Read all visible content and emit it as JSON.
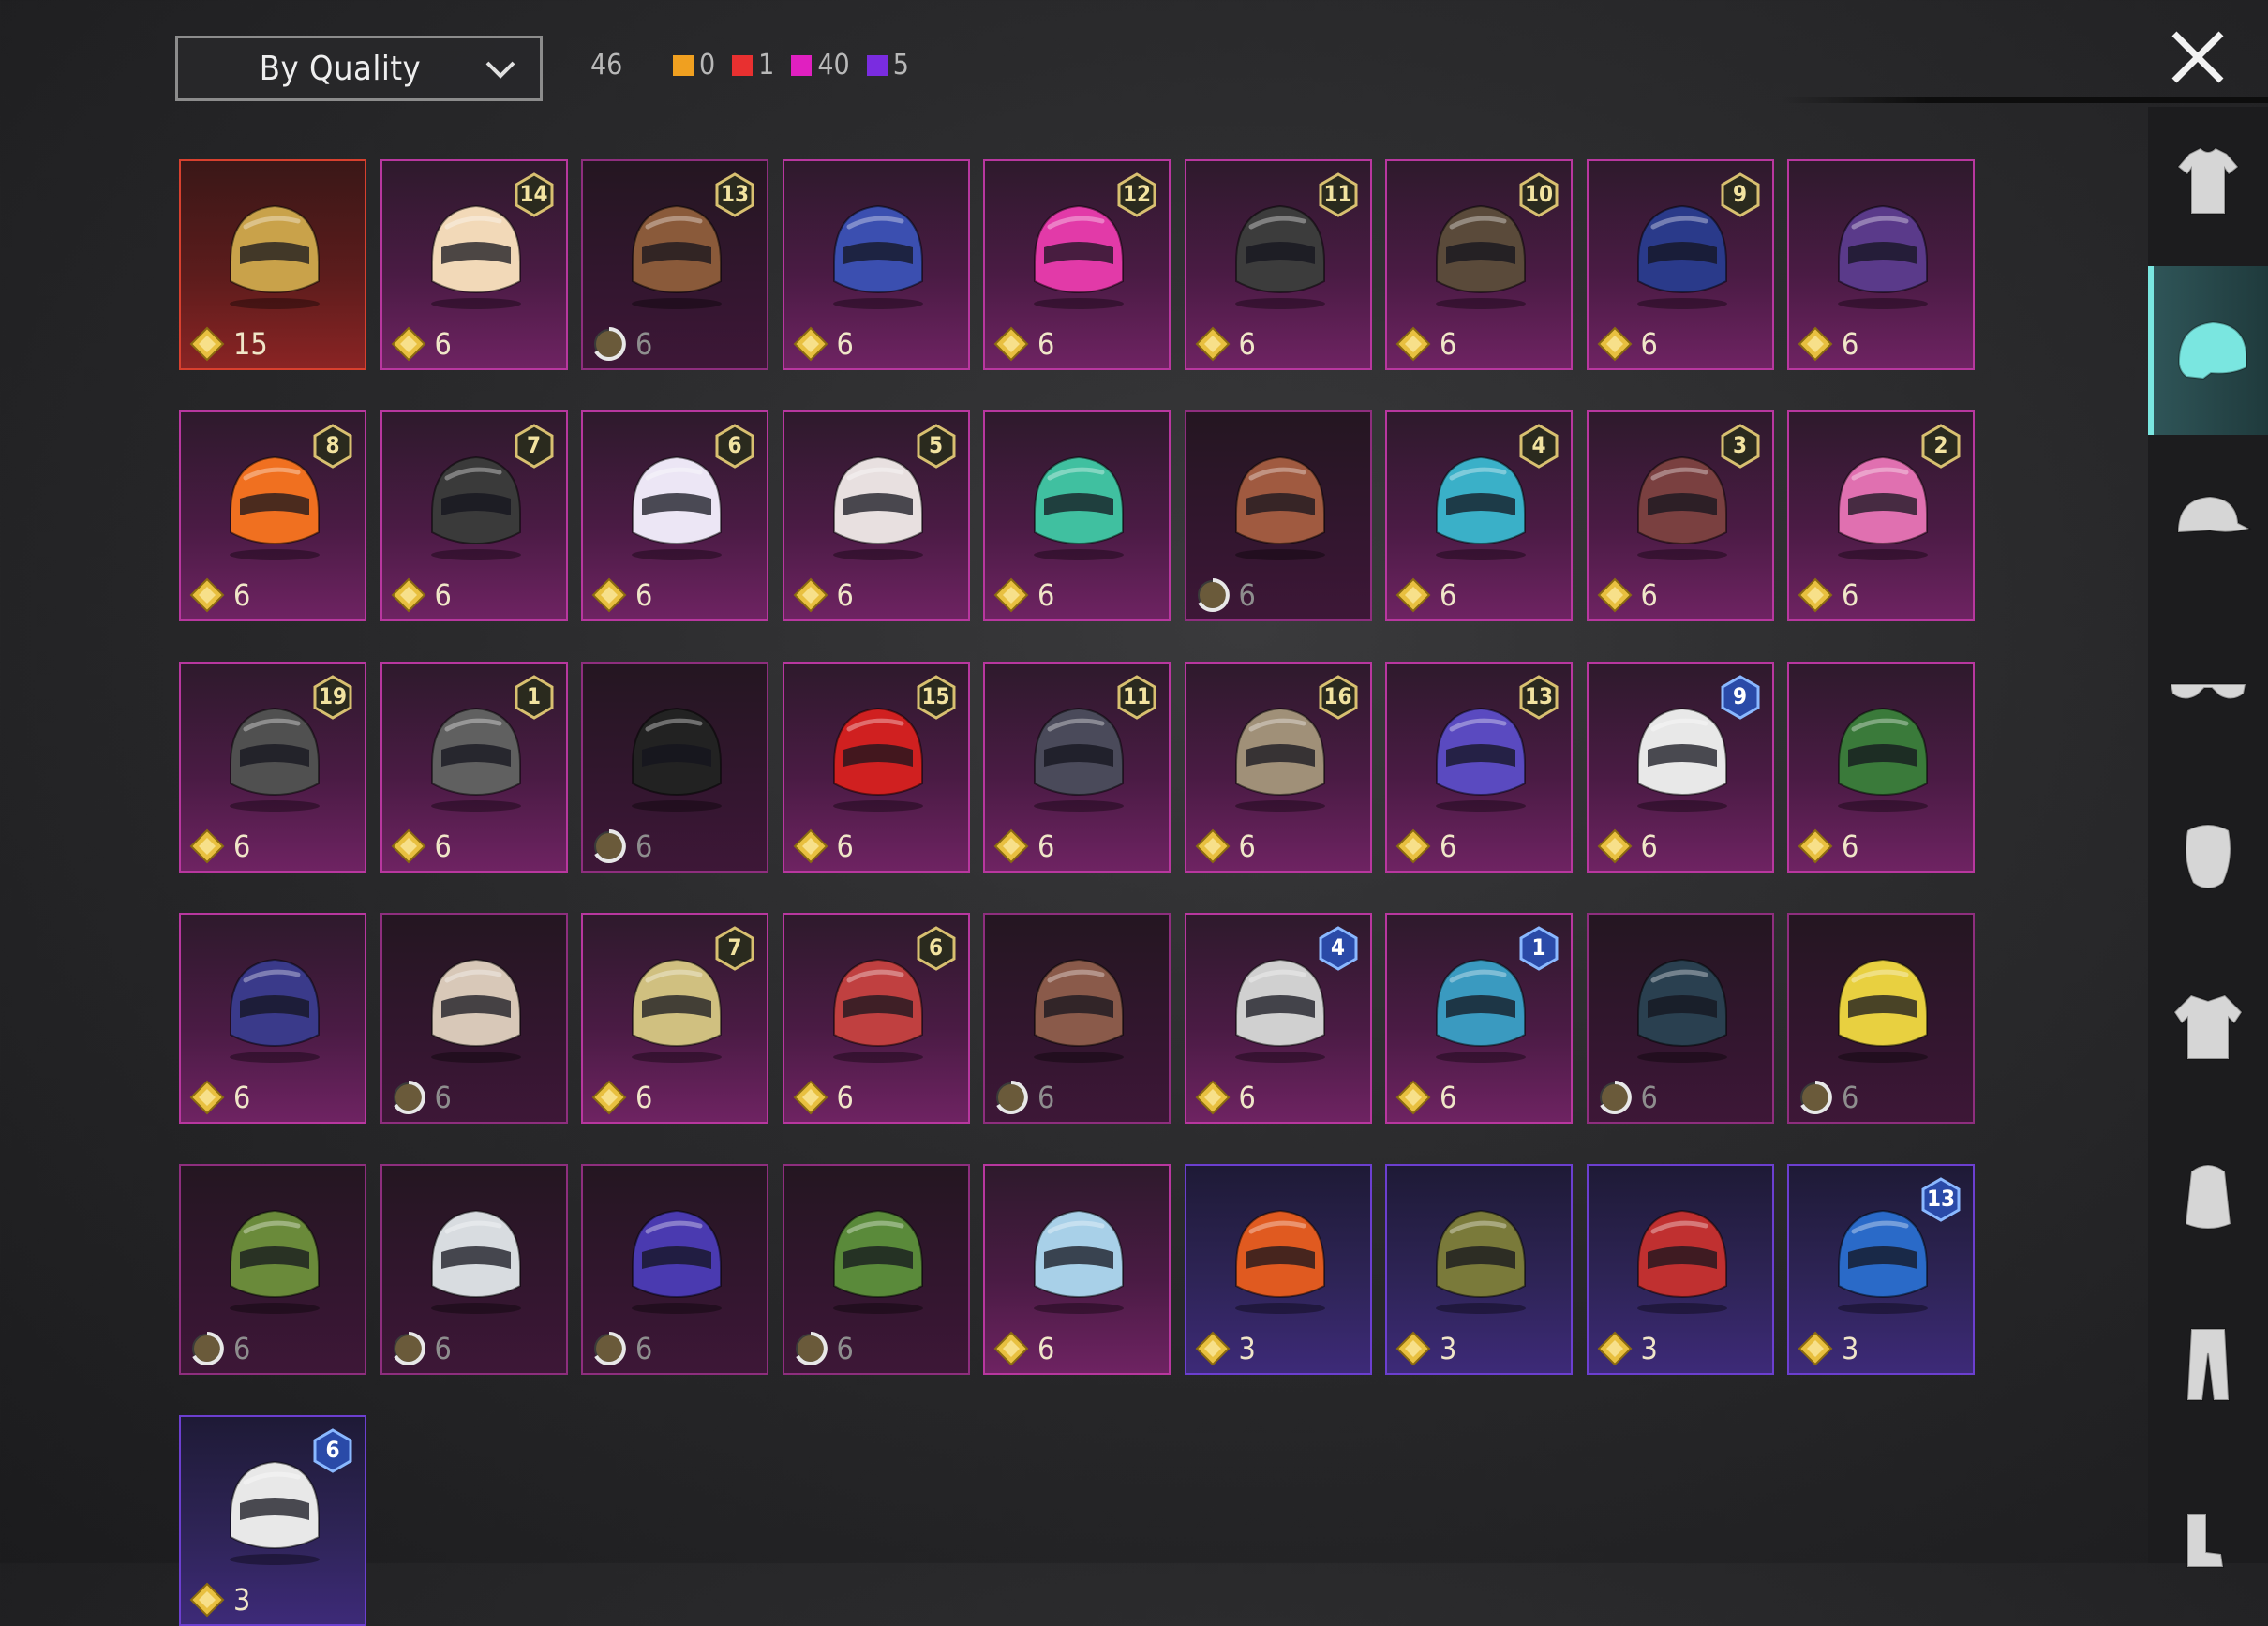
{
  "toolbar": {
    "sort_label": "By Quality",
    "total_count": "46",
    "quality_counts": [
      {
        "color": "#f0a020",
        "count": "0"
      },
      {
        "color": "#e83030",
        "count": "1"
      },
      {
        "color": "#e020c0",
        "count": "40"
      },
      {
        "color": "#7a2ce0",
        "count": "5"
      }
    ]
  },
  "sidebar": {
    "items": [
      {
        "icon": "shirt-icon",
        "active": false
      },
      {
        "icon": "helmet-icon",
        "active": true
      },
      {
        "icon": "cap-icon",
        "active": false
      },
      {
        "icon": "glasses-icon",
        "active": false
      },
      {
        "icon": "mask-icon",
        "active": false
      },
      {
        "icon": "jacket-icon",
        "active": false
      },
      {
        "icon": "backpack-icon",
        "active": false
      },
      {
        "icon": "pants-icon",
        "active": false
      },
      {
        "icon": "boots-icon",
        "active": false
      }
    ]
  },
  "items": [
    {
      "quality": "red",
      "color": "#c9a24a",
      "price": "15",
      "pending": false,
      "badge": ""
    },
    {
      "quality": "pink",
      "color": "#f2d9b8",
      "price": "6",
      "pending": false,
      "badge": "14"
    },
    {
      "quality": "pink",
      "color": "#8a5a3a",
      "price": "6",
      "pending": true,
      "badge": "13",
      "dim": true
    },
    {
      "quality": "pink",
      "color": "#3b4fb0",
      "price": "6",
      "pending": false,
      "badge": ""
    },
    {
      "quality": "pink",
      "color": "#e23aa8",
      "price": "6",
      "pending": false,
      "badge": "12"
    },
    {
      "quality": "pink",
      "color": "#3c3c3c",
      "price": "6",
      "pending": false,
      "badge": "11"
    },
    {
      "quality": "pink",
      "color": "#5a4a3a",
      "price": "6",
      "pending": false,
      "badge": "10"
    },
    {
      "quality": "pink",
      "color": "#2a3a8a",
      "price": "6",
      "pending": false,
      "badge": "9"
    },
    {
      "quality": "pink",
      "color": "#5a3a8a",
      "price": "6",
      "pending": false,
      "badge": ""
    },
    {
      "quality": "pink",
      "color": "#f07020",
      "price": "6",
      "pending": false,
      "badge": "8"
    },
    {
      "quality": "pink",
      "color": "#3a3a3a",
      "price": "6",
      "pending": false,
      "badge": "7"
    },
    {
      "quality": "pink",
      "color": "#ece6f5",
      "price": "6",
      "pending": false,
      "badge": "6"
    },
    {
      "quality": "pink",
      "color": "#e8e0e0",
      "price": "6",
      "pending": false,
      "badge": "5"
    },
    {
      "quality": "pink",
      "color": "#40c0a0",
      "price": "6",
      "pending": false,
      "badge": ""
    },
    {
      "quality": "pink",
      "color": "#a05a40",
      "price": "6",
      "pending": true,
      "badge": "",
      "dim": true
    },
    {
      "quality": "pink",
      "color": "#3ab0c8",
      "price": "6",
      "pending": false,
      "badge": "4"
    },
    {
      "quality": "pink",
      "color": "#7a4040",
      "price": "6",
      "pending": false,
      "badge": "3"
    },
    {
      "quality": "pink",
      "color": "#e070b0",
      "price": "6",
      "pending": false,
      "badge": "2"
    },
    {
      "quality": "pink",
      "color": "#505050",
      "price": "6",
      "pending": false,
      "badge": "19"
    },
    {
      "quality": "pink",
      "color": "#606060",
      "price": "6",
      "pending": false,
      "badge": "1"
    },
    {
      "quality": "pink",
      "color": "#222222",
      "price": "6",
      "pending": true,
      "badge": "",
      "dim": true
    },
    {
      "quality": "pink",
      "color": "#d02020",
      "price": "6",
      "pending": false,
      "badge": "15"
    },
    {
      "quality": "pink",
      "color": "#4a4a5a",
      "price": "6",
      "pending": false,
      "badge": "11"
    },
    {
      "quality": "pink",
      "color": "#a09078",
      "price": "6",
      "pending": false,
      "badge": "16"
    },
    {
      "quality": "pink",
      "color": "#5a4ac0",
      "price": "6",
      "pending": false,
      "badge": "13"
    },
    {
      "quality": "pink",
      "color": "#e8e8e8",
      "price": "6",
      "pending": false,
      "badge": "9",
      "badgeBlue": true
    },
    {
      "quality": "pink",
      "color": "#3a7a3a",
      "price": "6",
      "pending": false,
      "badge": ""
    },
    {
      "quality": "pink",
      "color": "#3a3a8a",
      "price": "6",
      "pending": false,
      "badge": ""
    },
    {
      "quality": "pink",
      "color": "#d8c8b8",
      "price": "6",
      "pending": true,
      "badge": "",
      "dim": true
    },
    {
      "quality": "pink",
      "color": "#d0c080",
      "price": "6",
      "pending": false,
      "badge": "7"
    },
    {
      "quality": "pink",
      "color": "#c04040",
      "price": "6",
      "pending": false,
      "badge": "6"
    },
    {
      "quality": "pink",
      "color": "#8a5a4a",
      "price": "6",
      "pending": true,
      "badge": "",
      "dim": true
    },
    {
      "quality": "pink",
      "color": "#d0d0d0",
      "price": "6",
      "pending": false,
      "badge": "4",
      "badgeBlue": true
    },
    {
      "quality": "pink",
      "color": "#3a9ac0",
      "price": "6",
      "pending": false,
      "badge": "1",
      "badgeBlue": true
    },
    {
      "quality": "pink",
      "color": "#2a4050",
      "price": "6",
      "pending": true,
      "badge": "",
      "dim": true
    },
    {
      "quality": "pink",
      "color": "#e8d040",
      "price": "6",
      "pending": true,
      "badge": "",
      "dim": true
    },
    {
      "quality": "pink",
      "color": "#6a8a3a",
      "price": "6",
      "pending": true,
      "badge": "",
      "dim": true
    },
    {
      "quality": "pink",
      "color": "#d8dce0",
      "price": "6",
      "pending": true,
      "badge": "",
      "dim": true
    },
    {
      "quality": "pink",
      "color": "#4a3ab0",
      "price": "6",
      "pending": true,
      "badge": "",
      "dim": true
    },
    {
      "quality": "pink",
      "color": "#5a8a3a",
      "price": "6",
      "pending": true,
      "badge": "",
      "dim": true
    },
    {
      "quality": "pink",
      "color": "#a8d0e8",
      "price": "6",
      "pending": false,
      "badge": ""
    },
    {
      "quality": "purple",
      "color": "#e05a20",
      "price": "3",
      "pending": false,
      "badge": ""
    },
    {
      "quality": "purple",
      "color": "#7a7a3a",
      "price": "3",
      "pending": false,
      "badge": ""
    },
    {
      "quality": "purple",
      "color": "#c03030",
      "price": "3",
      "pending": false,
      "badge": ""
    },
    {
      "quality": "purple",
      "color": "#2a6ac8",
      "price": "3",
      "pending": false,
      "badge": "13",
      "badgeBlue": true
    },
    {
      "quality": "purple",
      "color": "#e8e8e8",
      "price": "3",
      "pending": false,
      "badge": "6",
      "badgeBlue": true
    }
  ]
}
